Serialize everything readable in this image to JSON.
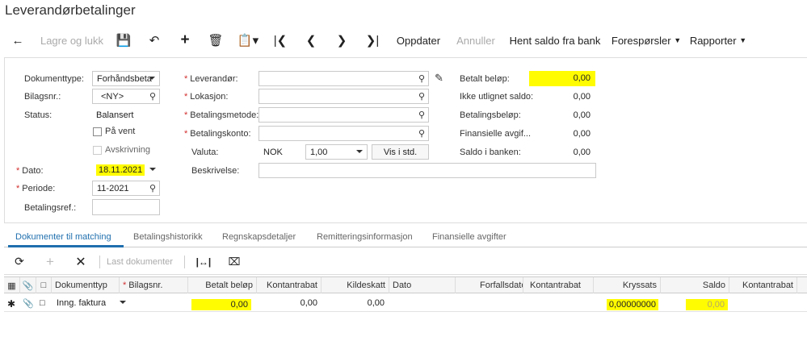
{
  "page": {
    "title": "Leverandørbetalinger"
  },
  "toolbar": {
    "save_close": "Lagre og lukk",
    "update": "Oppdater",
    "cancel": "Annuller",
    "fetch_balance": "Hent saldo fra bank",
    "inquiries": "Forespørsler",
    "reports": "Rapporter"
  },
  "form": {
    "doc_type_label": "Dokumenttype:",
    "doc_type_value": "Forhåndsbeta",
    "doc_no_label": "Bilagsnr.:",
    "doc_no_value": "<NY>",
    "status_label": "Status:",
    "status_value": "Balansert",
    "on_hold_label": "På vent",
    "write_off_label": "Avskrivning",
    "date_label": "Dato:",
    "date_value": "18.11.2021",
    "period_label": "Periode:",
    "period_value": "11-2021",
    "payment_ref_label": "Betalingsref.:",
    "vendor_label": "Leverandør:",
    "location_label": "Lokasjon:",
    "payment_method_label": "Betalingsmetode:",
    "payment_account_label": "Betalingskonto:",
    "currency_label": "Valuta:",
    "currency_value": "NOK",
    "rate_value": "1,00",
    "view_std_button": "Vis i std.",
    "description_label": "Beskrivelse:",
    "paid_amount_label": "Betalt beløp:",
    "paid_amount_value": "0,00",
    "unapplied_label": "Ikke utlignet saldo:",
    "unapplied_value": "0,00",
    "payment_amount_label": "Betalingsbeløp:",
    "payment_amount_value": "0,00",
    "finance_fee_label": "Finansielle avgif...",
    "finance_fee_value": "0,00",
    "bank_balance_label": "Saldo i banken:",
    "bank_balance_value": "0,00"
  },
  "tabs": [
    {
      "label": "Dokumenter til matching"
    },
    {
      "label": "Betalingshistorikk"
    },
    {
      "label": "Regnskapsdetaljer"
    },
    {
      "label": "Remitteringsinformasjon"
    },
    {
      "label": "Finansielle avgifter"
    }
  ],
  "gridbar": {
    "load_docs": "Last dokumenter"
  },
  "grid": {
    "headers": {
      "doc_type": "Dokumenttyp",
      "doc_no": "Bilagsnr.",
      "paid": "Betalt beløp",
      "cash_discount": "Kontantrabat",
      "withholding": "Kildeskatt",
      "date": "Dato",
      "due_date": "Forfallsdato",
      "cash_discount2": "Kontantrabat",
      "cross_rate": "Kryssats",
      "balance": "Saldo",
      "cash_discount3": "Kontantrabat"
    },
    "row": {
      "doc_type": "Inng. faktura",
      "paid": "0,00",
      "cash_discount": "0,00",
      "withholding": "0,00",
      "cross_rate": "0,00000000",
      "balance": "0,00"
    }
  },
  "colors": {
    "highlight": "#fffb00",
    "accent": "#1f6fae",
    "required": "#d32f2f"
  }
}
